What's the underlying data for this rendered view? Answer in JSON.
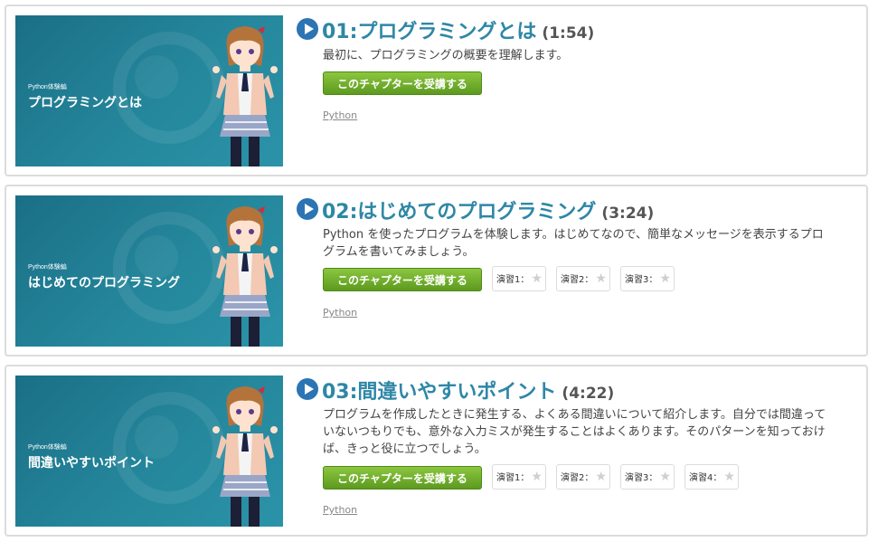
{
  "button_label": "このチャプターを受講する",
  "chapters": [
    {
      "number_title": "01:プログラミングとは",
      "duration": "(1:54)",
      "description": "最初に、プログラミングの概要を理解します。",
      "thumb_series": "Python体験編",
      "thumb_title": "プログラミングとは",
      "tag": "Python",
      "exercises": []
    },
    {
      "number_title": "02:はじめてのプログラミング",
      "duration": "(3:24)",
      "description": "Python を使ったプログラムを体験します。はじめてなので、簡単なメッセージを表示するプログラムを書いてみましょう。",
      "thumb_series": "Python体験編",
      "thumb_title": "はじめてのプログラミング",
      "tag": "Python",
      "exercises": [
        "演習1：",
        "演習2：",
        "演習3："
      ]
    },
    {
      "number_title": "03:間違いやすいポイント",
      "duration": "(4:22)",
      "description": "プログラムを作成したときに発生する、よくある間違いについて紹介します。自分では間違っていないつもりでも、意外な入力ミスが発生することはよくあります。そのパターンを知っておけば、きっと役に立つでしょう。",
      "thumb_series": "Python体験編",
      "thumb_title": "間違いやすいポイント",
      "tag": "Python",
      "exercises": [
        "演習1：",
        "演習2：",
        "演習3：",
        "演習4："
      ]
    }
  ],
  "colors": {
    "accent_blue": "#2e87a6",
    "button_green": "#6aa82a",
    "play_blue": "#2c74b3"
  },
  "icons": {
    "play": "play-circle-icon",
    "star": "star-icon"
  }
}
